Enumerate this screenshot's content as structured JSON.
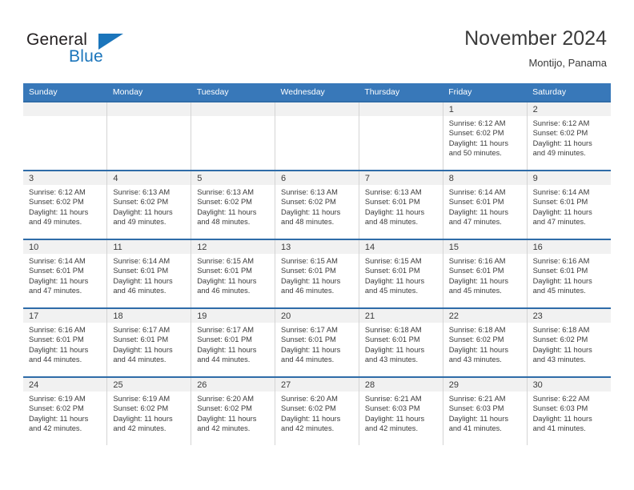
{
  "logo": {
    "line1": "General",
    "line2": "Blue",
    "triangle_color": "#1b75bb"
  },
  "header": {
    "title": "November 2024",
    "location": "Montijo, Panama"
  },
  "theme": {
    "header_row_bg": "#3878b9",
    "cell_top_border": "#2f6ca8",
    "daynum_band_bg": "#f1f1f1",
    "text_color": "#3b3b3b"
  },
  "weekdays": [
    "Sunday",
    "Monday",
    "Tuesday",
    "Wednesday",
    "Thursday",
    "Friday",
    "Saturday"
  ],
  "weeks": [
    [
      {
        "day": "",
        "lines": []
      },
      {
        "day": "",
        "lines": []
      },
      {
        "day": "",
        "lines": []
      },
      {
        "day": "",
        "lines": []
      },
      {
        "day": "",
        "lines": []
      },
      {
        "day": "1",
        "lines": [
          "Sunrise: 6:12 AM",
          "Sunset: 6:02 PM",
          "Daylight: 11 hours",
          "and 50 minutes."
        ]
      },
      {
        "day": "2",
        "lines": [
          "Sunrise: 6:12 AM",
          "Sunset: 6:02 PM",
          "Daylight: 11 hours",
          "and 49 minutes."
        ]
      }
    ],
    [
      {
        "day": "3",
        "lines": [
          "Sunrise: 6:12 AM",
          "Sunset: 6:02 PM",
          "Daylight: 11 hours",
          "and 49 minutes."
        ]
      },
      {
        "day": "4",
        "lines": [
          "Sunrise: 6:13 AM",
          "Sunset: 6:02 PM",
          "Daylight: 11 hours",
          "and 49 minutes."
        ]
      },
      {
        "day": "5",
        "lines": [
          "Sunrise: 6:13 AM",
          "Sunset: 6:02 PM",
          "Daylight: 11 hours",
          "and 48 minutes."
        ]
      },
      {
        "day": "6",
        "lines": [
          "Sunrise: 6:13 AM",
          "Sunset: 6:02 PM",
          "Daylight: 11 hours",
          "and 48 minutes."
        ]
      },
      {
        "day": "7",
        "lines": [
          "Sunrise: 6:13 AM",
          "Sunset: 6:01 PM",
          "Daylight: 11 hours",
          "and 48 minutes."
        ]
      },
      {
        "day": "8",
        "lines": [
          "Sunrise: 6:14 AM",
          "Sunset: 6:01 PM",
          "Daylight: 11 hours",
          "and 47 minutes."
        ]
      },
      {
        "day": "9",
        "lines": [
          "Sunrise: 6:14 AM",
          "Sunset: 6:01 PM",
          "Daylight: 11 hours",
          "and 47 minutes."
        ]
      }
    ],
    [
      {
        "day": "10",
        "lines": [
          "Sunrise: 6:14 AM",
          "Sunset: 6:01 PM",
          "Daylight: 11 hours",
          "and 47 minutes."
        ]
      },
      {
        "day": "11",
        "lines": [
          "Sunrise: 6:14 AM",
          "Sunset: 6:01 PM",
          "Daylight: 11 hours",
          "and 46 minutes."
        ]
      },
      {
        "day": "12",
        "lines": [
          "Sunrise: 6:15 AM",
          "Sunset: 6:01 PM",
          "Daylight: 11 hours",
          "and 46 minutes."
        ]
      },
      {
        "day": "13",
        "lines": [
          "Sunrise: 6:15 AM",
          "Sunset: 6:01 PM",
          "Daylight: 11 hours",
          "and 46 minutes."
        ]
      },
      {
        "day": "14",
        "lines": [
          "Sunrise: 6:15 AM",
          "Sunset: 6:01 PM",
          "Daylight: 11 hours",
          "and 45 minutes."
        ]
      },
      {
        "day": "15",
        "lines": [
          "Sunrise: 6:16 AM",
          "Sunset: 6:01 PM",
          "Daylight: 11 hours",
          "and 45 minutes."
        ]
      },
      {
        "day": "16",
        "lines": [
          "Sunrise: 6:16 AM",
          "Sunset: 6:01 PM",
          "Daylight: 11 hours",
          "and 45 minutes."
        ]
      }
    ],
    [
      {
        "day": "17",
        "lines": [
          "Sunrise: 6:16 AM",
          "Sunset: 6:01 PM",
          "Daylight: 11 hours",
          "and 44 minutes."
        ]
      },
      {
        "day": "18",
        "lines": [
          "Sunrise: 6:17 AM",
          "Sunset: 6:01 PM",
          "Daylight: 11 hours",
          "and 44 minutes."
        ]
      },
      {
        "day": "19",
        "lines": [
          "Sunrise: 6:17 AM",
          "Sunset: 6:01 PM",
          "Daylight: 11 hours",
          "and 44 minutes."
        ]
      },
      {
        "day": "20",
        "lines": [
          "Sunrise: 6:17 AM",
          "Sunset: 6:01 PM",
          "Daylight: 11 hours",
          "and 44 minutes."
        ]
      },
      {
        "day": "21",
        "lines": [
          "Sunrise: 6:18 AM",
          "Sunset: 6:01 PM",
          "Daylight: 11 hours",
          "and 43 minutes."
        ]
      },
      {
        "day": "22",
        "lines": [
          "Sunrise: 6:18 AM",
          "Sunset: 6:02 PM",
          "Daylight: 11 hours",
          "and 43 minutes."
        ]
      },
      {
        "day": "23",
        "lines": [
          "Sunrise: 6:18 AM",
          "Sunset: 6:02 PM",
          "Daylight: 11 hours",
          "and 43 minutes."
        ]
      }
    ],
    [
      {
        "day": "24",
        "lines": [
          "Sunrise: 6:19 AM",
          "Sunset: 6:02 PM",
          "Daylight: 11 hours",
          "and 42 minutes."
        ]
      },
      {
        "day": "25",
        "lines": [
          "Sunrise: 6:19 AM",
          "Sunset: 6:02 PM",
          "Daylight: 11 hours",
          "and 42 minutes."
        ]
      },
      {
        "day": "26",
        "lines": [
          "Sunrise: 6:20 AM",
          "Sunset: 6:02 PM",
          "Daylight: 11 hours",
          "and 42 minutes."
        ]
      },
      {
        "day": "27",
        "lines": [
          "Sunrise: 6:20 AM",
          "Sunset: 6:02 PM",
          "Daylight: 11 hours",
          "and 42 minutes."
        ]
      },
      {
        "day": "28",
        "lines": [
          "Sunrise: 6:21 AM",
          "Sunset: 6:03 PM",
          "Daylight: 11 hours",
          "and 42 minutes."
        ]
      },
      {
        "day": "29",
        "lines": [
          "Sunrise: 6:21 AM",
          "Sunset: 6:03 PM",
          "Daylight: 11 hours",
          "and 41 minutes."
        ]
      },
      {
        "day": "30",
        "lines": [
          "Sunrise: 6:22 AM",
          "Sunset: 6:03 PM",
          "Daylight: 11 hours",
          "and 41 minutes."
        ]
      }
    ]
  ]
}
